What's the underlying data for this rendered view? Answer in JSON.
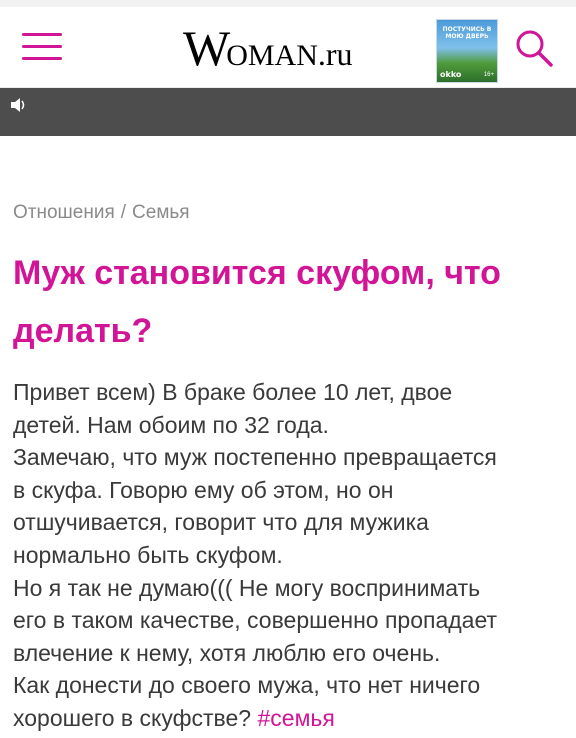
{
  "header": {
    "logo_w": "W",
    "logo_rest": "OMAN",
    "logo_ru": ".ru",
    "promo_title": "ПОСТУЧИСЬ В МОЮ ДВЕРЬ",
    "promo_brand": "okko",
    "promo_rating": "16+"
  },
  "breadcrumbs": [
    "Отношения",
    "Семья"
  ],
  "breadcrumb_separator": "/",
  "article": {
    "title": "Муж становится скуфом, что делать?",
    "lines": [
      "Привет всем) В браке более 10 лет, двое",
      "детей. Нам обоим по 32 года.",
      "Замечаю, что муж постепенно превращается",
      "в скуфа. Говорю ему об этом, но он",
      "отшучивается, говорит что для мужика",
      "нормально быть скуфом.",
      "Но я так не думаю((( Не могу воспринимать",
      "его в таком качестве, совершенно пропадает",
      "влечение к нему, хотя люблю его очень.",
      "Как донести до своего мужа, что нет ничего",
      "хорошего в скуфстве?"
    ],
    "hashtag": "#семья"
  },
  "colors": {
    "accent": "#d21496",
    "ad_background": "#f8d6e6",
    "text": "#3a3a3a",
    "breadcrumb": "#8a8a8a"
  },
  "icons": {
    "menu": "hamburger-icon",
    "search": "search-icon",
    "sound": "speaker-icon"
  }
}
